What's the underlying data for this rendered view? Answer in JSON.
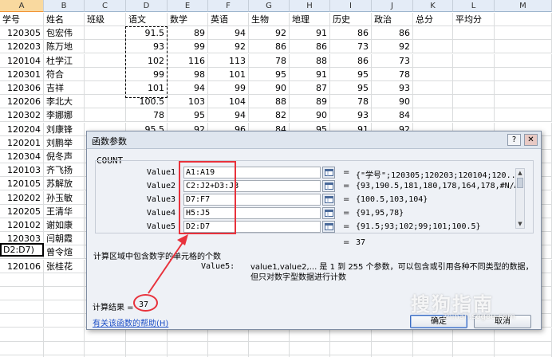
{
  "sheet": {
    "columns": [
      "A",
      "B",
      "C",
      "D",
      "E",
      "F",
      "G",
      "H",
      "I",
      "J",
      "K",
      "L",
      "M"
    ],
    "selected_column": "A",
    "headers": [
      "学号",
      "姓名",
      "班级",
      "语文",
      "数学",
      "英语",
      "生物",
      "地理",
      "历史",
      "政治",
      "总分",
      "平均分"
    ],
    "rows": [
      [
        "120305",
        "包宏伟",
        "",
        "91.5",
        "89",
        "94",
        "92",
        "91",
        "86",
        "86"
      ],
      [
        "120203",
        "陈万地",
        "",
        "93",
        "99",
        "92",
        "86",
        "86",
        "73",
        "92"
      ],
      [
        "120104",
        "杜学江",
        "",
        "102",
        "116",
        "113",
        "78",
        "88",
        "86",
        "73"
      ],
      [
        "120301",
        "符合",
        "",
        "99",
        "98",
        "101",
        "95",
        "91",
        "95",
        "78"
      ],
      [
        "120306",
        "吉祥",
        "",
        "101",
        "94",
        "99",
        "90",
        "87",
        "95",
        "93"
      ],
      [
        "120206",
        "李北大",
        "",
        "100.5",
        "103",
        "104",
        "88",
        "89",
        "78",
        "90"
      ],
      [
        "120302",
        "李娜娜",
        "",
        "78",
        "95",
        "94",
        "82",
        "90",
        "93",
        "84"
      ],
      [
        "120204",
        "刘康锋",
        "",
        "95.5",
        "92",
        "96",
        "84",
        "95",
        "91",
        "92"
      ],
      [
        "120201",
        "刘鹏举",
        "",
        "93.5",
        "107",
        "96",
        "100",
        "93",
        "92",
        "93"
      ],
      [
        "120304",
        "倪冬声",
        "",
        "",
        "",
        "",
        "",
        "",
        "",
        "",
        ""
      ],
      [
        "120103",
        "齐飞扬",
        "",
        "",
        "",
        "",
        "",
        "",
        "",
        "",
        ""
      ],
      [
        "120105",
        "苏解放",
        "",
        "",
        "",
        "",
        "",
        "",
        "",
        "",
        ""
      ],
      [
        "120202",
        "孙玉敏",
        "",
        "",
        "",
        "",
        "",
        "",
        "",
        "",
        ""
      ],
      [
        "120205",
        "王清华",
        "",
        "",
        "",
        "",
        "",
        "",
        "",
        "",
        ""
      ],
      [
        "120102",
        "谢如康",
        "",
        "",
        "",
        "",
        "",
        "",
        "",
        "",
        ""
      ],
      [
        "120303",
        "闫朝霞",
        "",
        "",
        "",
        "",
        "",
        "",
        "",
        "",
        ""
      ],
      [
        "120101",
        "曾令煊",
        "",
        "",
        "",
        "",
        "",
        "",
        "",
        "",
        ""
      ],
      [
        "120106",
        "张桂花",
        "",
        "",
        "",
        "",
        "",
        "",
        "",
        "",
        ""
      ]
    ],
    "formula_cell_text": "D2:D7)"
  },
  "dialog": {
    "title": "函数参数",
    "help_button": "?",
    "close_button": "✕",
    "function_name": "COUNT",
    "args": [
      {
        "label": "Value1",
        "input": "A1:A19",
        "value": "{\"学号\";120305;120203;120104;120..."
      },
      {
        "label": "Value2",
        "input": "C2:J2+D3:J3",
        "value": "{93,190.5,181,180,178,164,178,#N/A}"
      },
      {
        "label": "Value3",
        "input": "D7:F7",
        "value": "{100.5,103,104}"
      },
      {
        "label": "Value4",
        "input": "H5:J5",
        "value": "{91,95,78}"
      },
      {
        "label": "Value5",
        "input": "D2:D7",
        "value": "{91.5;93;102;99;101;100.5}"
      }
    ],
    "eq": "=",
    "total_value": "37",
    "description": "计算区域中包含数字的单元格的个数",
    "arg_desc_label": "Value5:",
    "arg_desc": "value1,value2,... 是 1 到 255 个参数，可以包含或引用各种不同类型的数据，但只对数字型数据进行计数",
    "result_label": "计算结果 =",
    "result_value": "37",
    "help_link": "有关该函数的帮助(H)",
    "ok_label": "确定",
    "cancel_label": "取消"
  },
  "watermark": {
    "text": "搜狗指南",
    "url": "zhinan.sogou.com"
  },
  "colors": {
    "annotation_red": "#e8323c",
    "header_bg": "#e4ecf7",
    "selected_header": "#f9d99f"
  }
}
